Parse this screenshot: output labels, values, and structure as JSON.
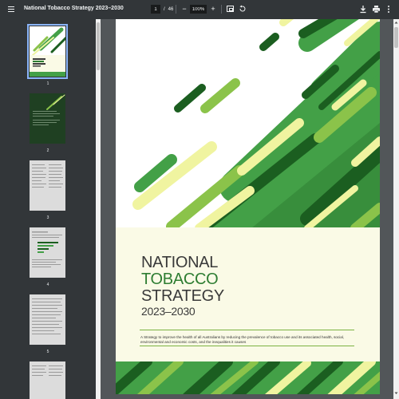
{
  "toolbar": {
    "title": "National Tobacco Strategy 2023–2030",
    "current_page": "1",
    "page_separator": "/",
    "total_pages": "46",
    "zoom_out_label": "−",
    "zoom_value": "100%",
    "zoom_in_label": "+",
    "icons": [
      "menu-icon",
      "fit-page-icon",
      "rotate-icon",
      "download-icon",
      "print-icon",
      "more-vert-icon"
    ]
  },
  "sidebar": {
    "thumbnails": [
      {
        "number": "1",
        "selected": true
      },
      {
        "number": "2",
        "selected": false
      },
      {
        "number": "3",
        "selected": false
      },
      {
        "number": "4",
        "selected": false
      },
      {
        "number": "5",
        "selected": false
      }
    ]
  },
  "cover": {
    "title_line1": "NATIONAL",
    "title_line2": "TOBACCO",
    "title_line3": "STRATEGY",
    "years": "2023–2030",
    "subtitle": "A Strategy to improve the health of all Australians by reducing the prevalence of tobacco use and its associated health, social, environmental and economic costs, and the inequalities it causes",
    "colors": {
      "dark_green": "#1b5e20",
      "mid_green": "#43a047",
      "light_green": "#8bc34a",
      "pale_yellow": "#f0f4a0",
      "cream": "#fafae6",
      "title_green": "#2e7d32"
    }
  }
}
